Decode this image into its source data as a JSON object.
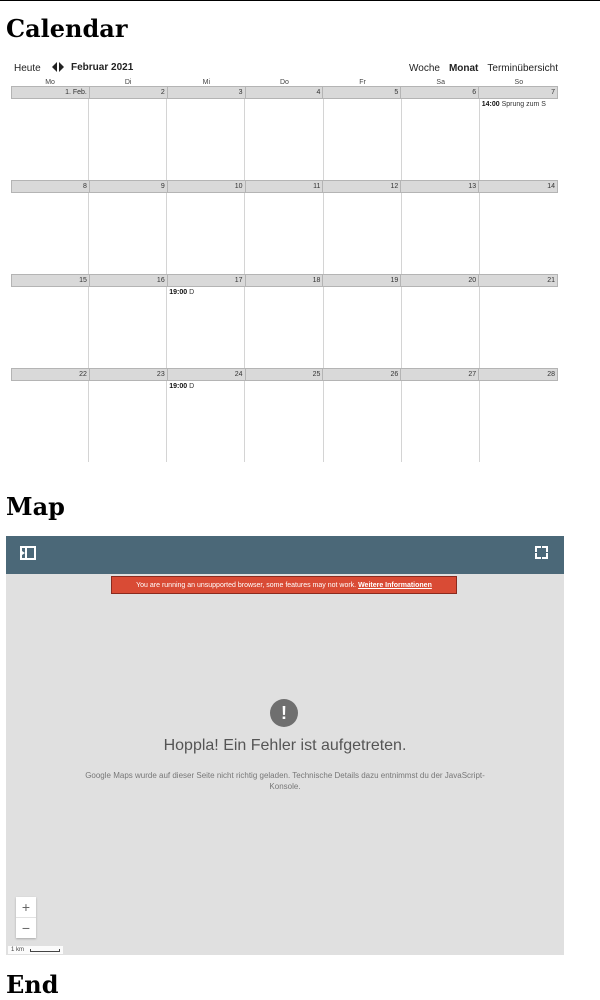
{
  "headings": {
    "calendar": "Calendar",
    "map": "Map",
    "end": "End"
  },
  "calendar": {
    "toolbar": {
      "today_label": "Heute",
      "month_label": "Februar 2021",
      "views": {
        "week": "Woche",
        "month": "Monat",
        "agenda": "Terminübersicht"
      },
      "active_view": "Monat"
    },
    "weekdays": [
      "Mo",
      "Di",
      "Mi",
      "Do",
      "Fr",
      "Sa",
      "So"
    ],
    "weeks": [
      {
        "days": [
          "1. Feb.",
          "2",
          "3",
          "4",
          "5",
          "6",
          "7"
        ]
      },
      {
        "days": [
          "8",
          "9",
          "10",
          "11",
          "12",
          "13",
          "14"
        ]
      },
      {
        "days": [
          "15",
          "16",
          "17",
          "18",
          "19",
          "20",
          "21"
        ]
      },
      {
        "days": [
          "22",
          "23",
          "24",
          "25",
          "26",
          "27",
          "28"
        ]
      }
    ],
    "events": [
      {
        "time": "14:00",
        "title": "Sprung zum S"
      },
      {
        "time": "19:00",
        "title": "D"
      },
      {
        "time": "19:00",
        "title": "D"
      }
    ]
  },
  "map": {
    "warning_text": "You are running an unsupported browser, some features may not work.",
    "warning_link": "Weitere Informationen",
    "error_icon": "!",
    "error_title": "Hoppla! Ein Fehler ist aufgetreten.",
    "error_description": "Google Maps wurde auf dieser Seite nicht richtig geladen. Technische Details dazu entnimmst du der JavaScript-Konsole.",
    "zoom_in": "+",
    "zoom_out": "−",
    "scale_label": "1 km",
    "icons": {
      "sidebar": "sidebar-toggle-icon",
      "fullscreen": "fullscreen-icon",
      "error": "exclamation-icon"
    },
    "colors": {
      "toolbar": "#4b6878",
      "warning": "#d94b35",
      "background": "#e0e0e0"
    }
  }
}
